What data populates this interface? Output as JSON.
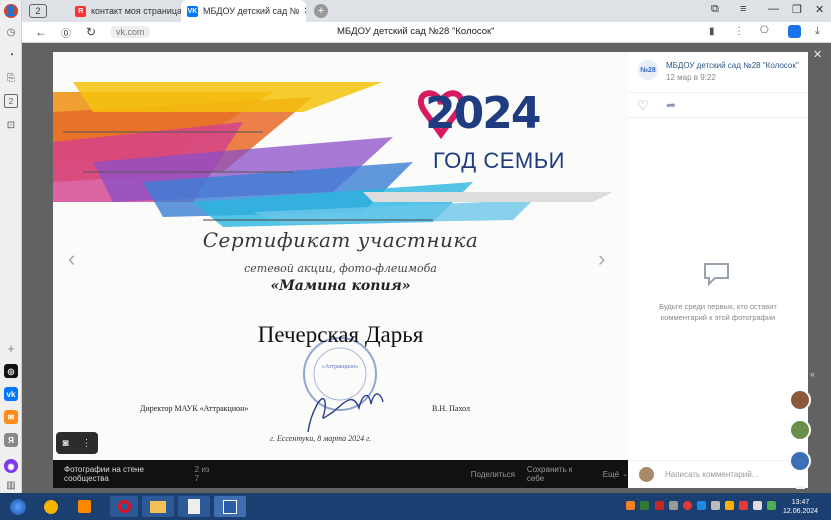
{
  "browser": {
    "tab_count": "2",
    "tabs": [
      {
        "favicon": "Я",
        "title": "контакт моя страница —",
        "active": false
      },
      {
        "favicon": "VK",
        "title": "МБДОУ детский сад №",
        "active": true
      }
    ],
    "new_tab_symbol": "+",
    "url_domain": "vk.com",
    "page_title": "МБДОУ детский сад №28 \"Колосок\"",
    "sidebar_badge": "2"
  },
  "certificate": {
    "logo_year": "2024",
    "logo_caption": "ГОД СЕМЬИ",
    "title": "Сертификат участника",
    "subtitle": "сетевой акции, фото-флешмоба",
    "quote": "«Мамина копия»",
    "recipient": "Печерская Дарья",
    "director": "Директор МАУК «Аттракцион»",
    "signatory": "В.Н. Пахол",
    "date_line": "г. Ессентуки, 8 марта 2024 г.",
    "stamp_text": "«Аттракцион»"
  },
  "viewer_footer": {
    "album": "Фотографии на стене сообщества",
    "counter": "2 из 7",
    "share": "Поделиться",
    "save": "Сохранить к себе",
    "more": "Ещё"
  },
  "post": {
    "group_name": "МБДОУ детский сад №28 \"Колосок\"",
    "avatar_text": "№28",
    "date": "12 мар в 9:22",
    "empty_comments": "Будьте среди первых, кто оставит комментарий к этой фотографии",
    "comment_placeholder": "Написать комментарий..."
  },
  "taskbar": {
    "time": "13:47",
    "date": "12.06.2024"
  },
  "colors": {
    "vk_blue": "#0077ff",
    "taskbar": "#1c3f72",
    "logo_blue": "#1f3c80",
    "logo_heart": "#d81b60"
  },
  "icons": [
    "heart-icon",
    "share-icon",
    "comment-icon",
    "camera-icon",
    "more-icon",
    "chevron-left-icon",
    "chevron-right-icon"
  ]
}
